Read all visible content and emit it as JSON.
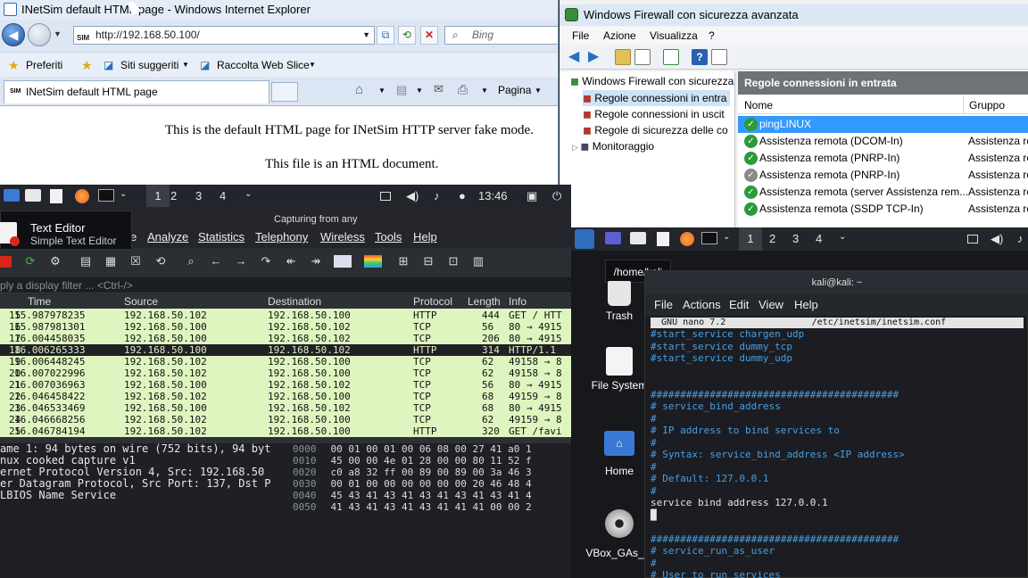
{
  "ie": {
    "title": "INetSim default HTML page - Windows Internet Explorer",
    "address": "http://192.168.50.100/",
    "address_badge": "SIM",
    "search_placeholder": "Bing",
    "favorites": "Preferiti",
    "suggested": "Siti suggeriti",
    "webslice": "Raccolta Web Slice",
    "tab_title": "INetSim default HTML page",
    "tab_badge": "SIM",
    "page_menu": "Pagina",
    "page_line1": "This is the default HTML page for INetSim HTTP server fake mode.",
    "page_line2": "This file is an HTML document."
  },
  "firewall": {
    "title": "Windows Firewall con sicurezza avanzata",
    "menu": [
      "File",
      "Azione",
      "Visualizza",
      "?"
    ],
    "tree": [
      "Windows Firewall con sicurezza",
      "Regole connessioni in entra",
      "Regole connessioni in uscit",
      "Regole di sicurezza delle co",
      "Monitoraggio"
    ],
    "pane_title": "Regole connessioni in entrata",
    "col_name": "Nome",
    "col_group": "Gruppo",
    "rules": [
      {
        "name": "pingLINUX",
        "group": ""
      },
      {
        "name": "Assistenza remota (DCOM-In)",
        "group": "Assistenza re"
      },
      {
        "name": "Assistenza remota (PNRP-In)",
        "group": "Assistenza re"
      },
      {
        "name": "Assistenza remota (PNRP-In)",
        "group": "Assistenza re"
      },
      {
        "name": "Assistenza remota (server Assistenza rem...",
        "group": "Assistenza re"
      },
      {
        "name": "Assistenza remota (SSDP TCP-In)",
        "group": "Assistenza re"
      }
    ]
  },
  "kali_left": {
    "workspaces": [
      "1",
      "2",
      "3",
      "4"
    ],
    "time": "13:46"
  },
  "tooltip": {
    "title": "Text Editor",
    "subtitle": "Simple Text Editor"
  },
  "wireshark": {
    "capturing": "Capturing from any",
    "menu": [
      "Analyze",
      "Statistics",
      "Telephony",
      "Wireless",
      "Tools",
      "Help"
    ],
    "menu_partial": "e",
    "filter_placeholder": "ply a display filter ... <Ctrl-/>",
    "columns": [
      "Time",
      "Source",
      "Destination",
      "Protocol",
      "Length",
      "Info"
    ],
    "packets": [
      {
        "no": "15",
        "time": "15.987978235",
        "src": "192.168.50.102",
        "dst": "192.168.50.100",
        "proto": "HTTP",
        "len": "444",
        "info": "GET / HTT"
      },
      {
        "no": "16",
        "time": "15.987981301",
        "src": "192.168.50.100",
        "dst": "192.168.50.102",
        "proto": "TCP",
        "len": "56",
        "info": "80 → 4915"
      },
      {
        "no": "17",
        "time": "16.004458035",
        "src": "192.168.50.100",
        "dst": "192.168.50.102",
        "proto": "TCP",
        "len": "206",
        "info": "80 → 4915"
      },
      {
        "no": "18",
        "time": "16.006265333",
        "src": "192.168.50.100",
        "dst": "192.168.50.102",
        "proto": "HTTP",
        "len": "314",
        "info": "HTTP/1.1"
      },
      {
        "no": "19",
        "time": "16.006448245",
        "src": "192.168.50.102",
        "dst": "192.168.50.100",
        "proto": "TCP",
        "len": "62",
        "info": "49158 → 8"
      },
      {
        "no": "20",
        "time": "16.007022996",
        "src": "192.168.50.102",
        "dst": "192.168.50.100",
        "proto": "TCP",
        "len": "62",
        "info": "49158 → 8"
      },
      {
        "no": "21",
        "time": "16.007036963",
        "src": "192.168.50.100",
        "dst": "192.168.50.102",
        "proto": "TCP",
        "len": "56",
        "info": "80 → 4915"
      },
      {
        "no": "22",
        "time": "16.046458422",
        "src": "192.168.50.102",
        "dst": "192.168.50.100",
        "proto": "TCP",
        "len": "68",
        "info": "49159 → 8"
      },
      {
        "no": "23",
        "time": "16.046533469",
        "src": "192.168.50.100",
        "dst": "192.168.50.102",
        "proto": "TCP",
        "len": "68",
        "info": "80 → 4915"
      },
      {
        "no": "24",
        "time": "16.046668256",
        "src": "192.168.50.102",
        "dst": "192.168.50.100",
        "proto": "TCP",
        "len": "62",
        "info": "49159 → 8"
      },
      {
        "no": "25",
        "time": "16.046784194",
        "src": "192.168.50.102",
        "dst": "192.168.50.100",
        "proto": "HTTP",
        "len": "320",
        "info": "GET /favi"
      }
    ],
    "details": [
      "ame 1: 94 bytes on wire (752 bits), 94 byt",
      "nux cooked capture v1",
      "ernet Protocol Version 4, Src: 192.168.50",
      "er Datagram Protocol, Src Port: 137, Dst P",
      "LBIOS Name Service"
    ],
    "hex": [
      {
        "off": "0000",
        "bytes": "00 01 00 01 00 06 08 00  27 41 a0 1"
      },
      {
        "off": "0010",
        "bytes": "45 00 00 4e 01 28 00 00  80 11 52 f"
      },
      {
        "off": "0020",
        "bytes": "c0 a8 32 ff 00 89 00 89  00 3a 46 3"
      },
      {
        "off": "0030",
        "bytes": "00 01 00 00 00 00 00 00  20 46 48 4"
      },
      {
        "off": "0040",
        "bytes": "45 43 41 43 41 43 41 43  41 43 41 4"
      },
      {
        "off": "0050",
        "bytes": "41 43 41 43 41 43 41 41  41 00 00 2"
      }
    ]
  },
  "kali_right": {
    "workspaces": [
      "1",
      "2",
      "3",
      "4"
    ],
    "path_tip": "/home/kali",
    "desktop": [
      "Trash",
      "File System",
      "Home",
      "VBox_GAs_..."
    ],
    "term_title": "kali@kali: ~",
    "term_menu": [
      "File",
      "Actions",
      "Edit",
      "View",
      "Help"
    ],
    "nano_header": "  GNU nano 7.2                /etc/inetsim/inetsim.conf",
    "lines": [
      {
        "t": "#start_service chargen_udp",
        "c": "c"
      },
      {
        "t": "#start_service dummy_tcp",
        "c": "c"
      },
      {
        "t": "#start_service dummy_udp",
        "c": "c"
      },
      {
        "t": "",
        "c": "c"
      },
      {
        "t": "",
        "c": "c"
      },
      {
        "t": "##########################################",
        "c": "c"
      },
      {
        "t": "# service_bind_address",
        "c": "c"
      },
      {
        "t": "#",
        "c": "c"
      },
      {
        "t": "# IP address to bind services to",
        "c": "c"
      },
      {
        "t": "#",
        "c": "c"
      },
      {
        "t": "# Syntax: service_bind_address <IP address>",
        "c": "c"
      },
      {
        "t": "#",
        "c": "c"
      },
      {
        "t": "# Default: 127.0.0.1",
        "c": "c"
      },
      {
        "t": "#",
        "c": "c"
      },
      {
        "t": "service bind address 127.0.0.1",
        "c": "w"
      },
      {
        "t": "█",
        "c": "w"
      },
      {
        "t": "",
        "c": "c"
      },
      {
        "t": "##########################################",
        "c": "c"
      },
      {
        "t": "# service_run_as_user",
        "c": "c"
      },
      {
        "t": "#",
        "c": "c"
      },
      {
        "t": "# User to run services",
        "c": "c"
      },
      {
        "t": "#",
        "c": "c"
      }
    ]
  }
}
